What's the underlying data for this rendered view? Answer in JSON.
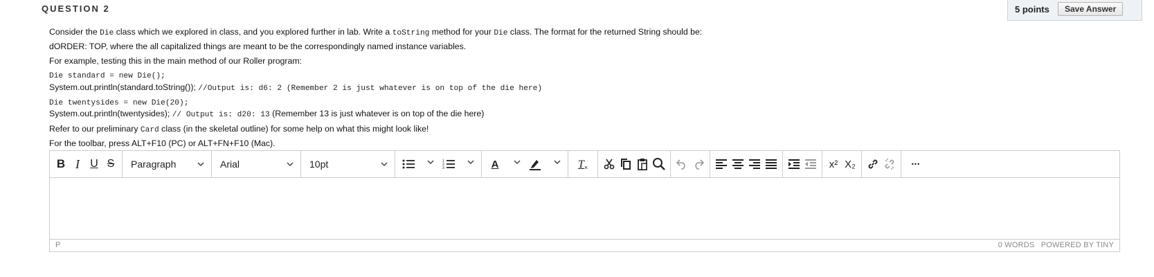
{
  "question": {
    "title": "QUESTION 2",
    "points": "5 points",
    "save_label": "Save Answer"
  },
  "prompt": {
    "l1_a": "Consider the ",
    "l1_code1": "Die",
    "l1_b": " class which we explored in class, and you explored further in lab. Write a ",
    "l1_code2": "toString",
    "l1_c": " method for your ",
    "l1_code3": "Die",
    "l1_d": " class. The format for the returned String should be:",
    "l2": "dORDER: TOP, where the all capitalized things are meant to be the correspondingly named instance variables.",
    "l3": "For example, testing this in the main method of our Roller program:",
    "code1": "Die standard = new Die();",
    "l5_a": "System.out.println(standard.toString()); ",
    "l5_code": "//Output is: d6: 2 (Remember 2 is just whatever is on top of the die here)",
    "code2": "Die twentysides = new Die(20);",
    "l7_a": "System.out.println(twentysides); ",
    "l7_code": "// Output is: d20: 13",
    "l7_b": " (Remember 13 is just whatever is on top of the die here)",
    "l8_a": "Refer to our preliminary ",
    "l8_code": "Card",
    "l8_b": " class (in the skeletal outline) for some help on what this might look like!",
    "l9": "For the toolbar, press ALT+F10 (PC) or ALT+FN+F10 (Mac)."
  },
  "editor": {
    "toolbar": {
      "bold": "B",
      "italic": "I",
      "underline": "U",
      "strikethrough": "S",
      "block_format": "Paragraph",
      "font_family": "Arial",
      "font_size": "10pt",
      "text_color_letter": "A",
      "clear_format": "T",
      "superscript": "x²",
      "subscript": "X₂",
      "more": "•••"
    },
    "status": {
      "path": "P",
      "words": "0 WORDS",
      "powered": "POWERED BY TINY"
    }
  }
}
